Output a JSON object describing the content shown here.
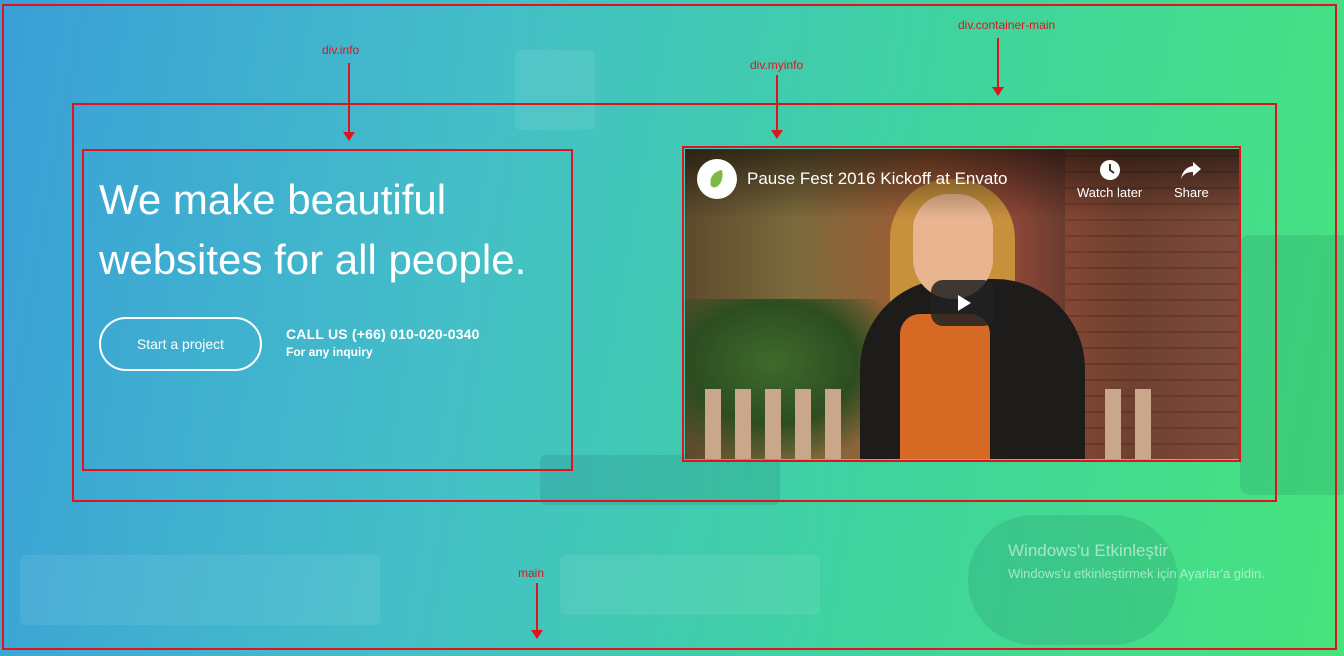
{
  "annotations": {
    "info": "div.info",
    "myinfo": "div.myinfo",
    "container_main": "div.container-main",
    "main": "main"
  },
  "hero": {
    "headline": "We make beautiful websites for all people.",
    "cta_label": "Start a project",
    "call_title": "CALL US (+66) 010-020-0340",
    "call_subtitle": "For any inquiry"
  },
  "video": {
    "title": "Pause Fest 2016 Kickoff at Envato",
    "watch_later_label": "Watch later",
    "share_label": "Share",
    "channel_icon": "envato-leaf-icon",
    "play_icon": "play-icon"
  },
  "watermark": {
    "title": "Windows'u Etkinleştir",
    "subtitle": "Windows'u etkinleştirmek için Ayarlar'a gidin."
  },
  "colors": {
    "annotation": "#e0141e",
    "gradient_start": "#3a9fd8",
    "gradient_end": "#47e47d"
  }
}
